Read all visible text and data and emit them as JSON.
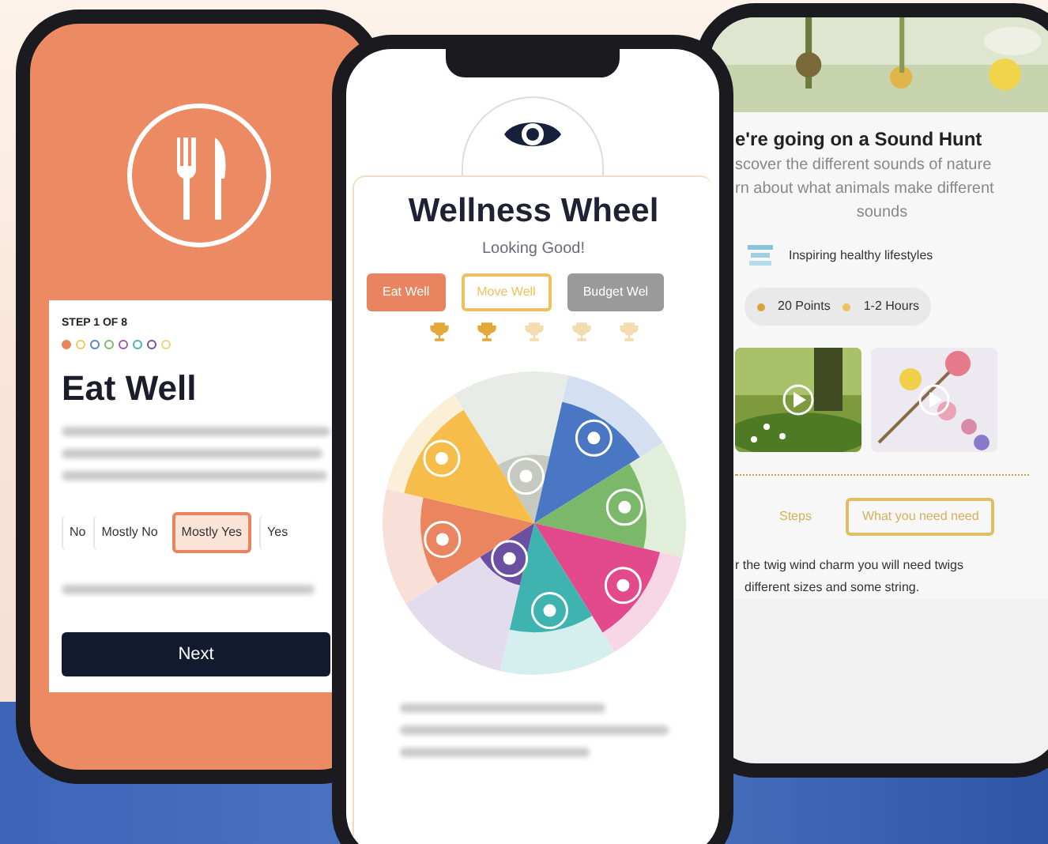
{
  "eat_well_screen": {
    "step_label": "STEP 1 OF 8",
    "steps": [
      {
        "color": "#e8845f",
        "done": true
      },
      {
        "color": "#f2c65a",
        "done": false
      },
      {
        "color": "#4f7fc9",
        "done": false
      },
      {
        "color": "#7cb86a",
        "done": false
      },
      {
        "color": "#9b5bb5",
        "done": false
      },
      {
        "color": "#3fb3b0",
        "done": false
      },
      {
        "color": "#6a4fa3",
        "done": false
      },
      {
        "color": "#f0d27a",
        "done": false
      }
    ],
    "title": "Eat Well",
    "options": [
      {
        "label": "No",
        "selected": false
      },
      {
        "label": "Mostly No",
        "selected": false
      },
      {
        "label": "Mostly Yes",
        "selected": true
      },
      {
        "label": "Yes",
        "selected": false
      }
    ],
    "next_button": "Next"
  },
  "wellness_screen": {
    "title": "Wellness Wheel",
    "subtitle": "Looking Good!",
    "tabs": [
      {
        "label": "Eat Well",
        "kind": "filled",
        "color": "#e8845f"
      },
      {
        "label": "Move Well",
        "kind": "outline",
        "color": "#f0c060"
      },
      {
        "label": "Budget Wel",
        "kind": "filled",
        "color": "#9a9a9a"
      }
    ],
    "stars": 2
  },
  "sound_hunt_screen": {
    "title": "e're going on a Sound Hunt",
    "description_lines": [
      "scover the different sounds of nature",
      "rn about what animals make different",
      "sounds"
    ],
    "tagline": "Inspiring healthy lifestyles",
    "points": "20 Points",
    "duration": "1-2 Hours",
    "tabs": [
      {
        "label": "Steps",
        "selected": false
      },
      {
        "label": "What you need need",
        "selected": true
      }
    ],
    "body_lines": [
      "r the twig wind charm you will need twigs",
      "different sizes and some string."
    ]
  }
}
